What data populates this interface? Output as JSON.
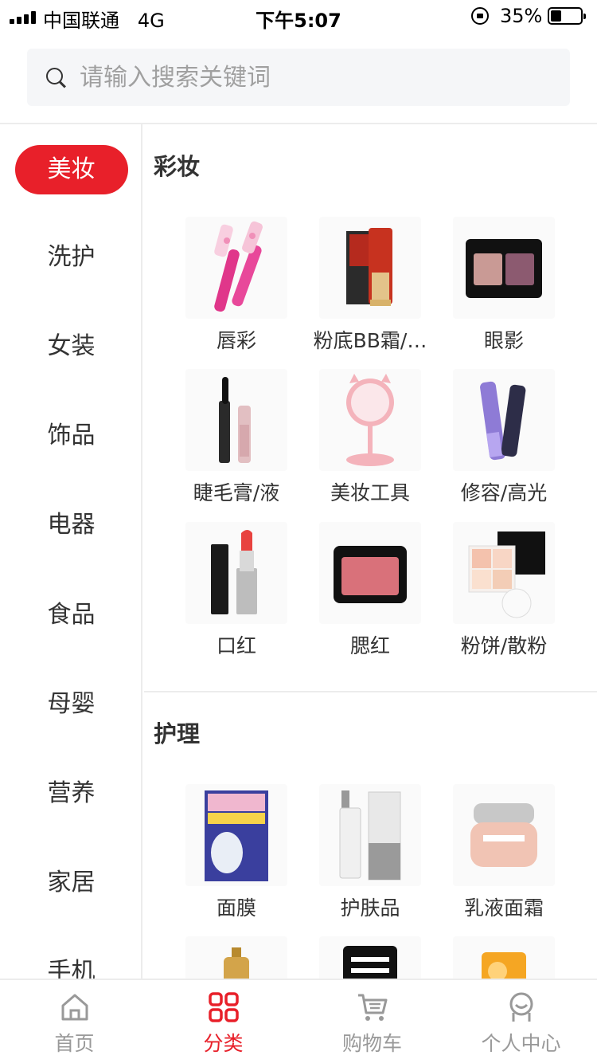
{
  "status": {
    "carrier": "中国联通",
    "network": "4G",
    "time": "下午5:07",
    "battery": "35%"
  },
  "search": {
    "placeholder": "请输入搜索关键词",
    "icon": "search-icon"
  },
  "sidebar": {
    "items": [
      {
        "label": "美妆",
        "active": true
      },
      {
        "label": "洗护"
      },
      {
        "label": "女装"
      },
      {
        "label": "饰品"
      },
      {
        "label": "电器"
      },
      {
        "label": "食品"
      },
      {
        "label": "母婴"
      },
      {
        "label": "营养"
      },
      {
        "label": "家居"
      },
      {
        "label": "手机"
      }
    ]
  },
  "sections": [
    {
      "title": "彩妆",
      "items": [
        {
          "label": "唇彩",
          "icon": "lip-gloss"
        },
        {
          "label": "粉底BB霜/…",
          "icon": "bb-cream"
        },
        {
          "label": "眼影",
          "icon": "eyeshadow"
        },
        {
          "label": "睫毛膏/液",
          "icon": "mascara"
        },
        {
          "label": "美妆工具",
          "icon": "mirror"
        },
        {
          "label": "修容/高光",
          "icon": "contour-stick"
        },
        {
          "label": "口红",
          "icon": "lipstick"
        },
        {
          "label": "腮红",
          "icon": "blush"
        },
        {
          "label": "粉饼/散粉",
          "icon": "powder"
        }
      ]
    },
    {
      "title": "护理",
      "items": [
        {
          "label": "面膜",
          "icon": "face-mask"
        },
        {
          "label": "护肤品",
          "icon": "toner"
        },
        {
          "label": "乳液面霜",
          "icon": "cream-jar"
        },
        {
          "label": "",
          "icon": "spray-bottle"
        },
        {
          "label": "",
          "icon": "coffee-scrub"
        },
        {
          "label": "",
          "icon": "orange-pack"
        }
      ]
    }
  ],
  "tabbar": {
    "items": [
      {
        "label": "首页",
        "icon": "home-icon"
      },
      {
        "label": "分类",
        "icon": "category-icon",
        "active": true
      },
      {
        "label": "购物车",
        "icon": "cart-icon"
      },
      {
        "label": "个人中心",
        "icon": "user-icon"
      }
    ]
  },
  "colors": {
    "accent": "#e8202a",
    "divider": "#ececec",
    "search_bg": "#f5f6f8"
  }
}
